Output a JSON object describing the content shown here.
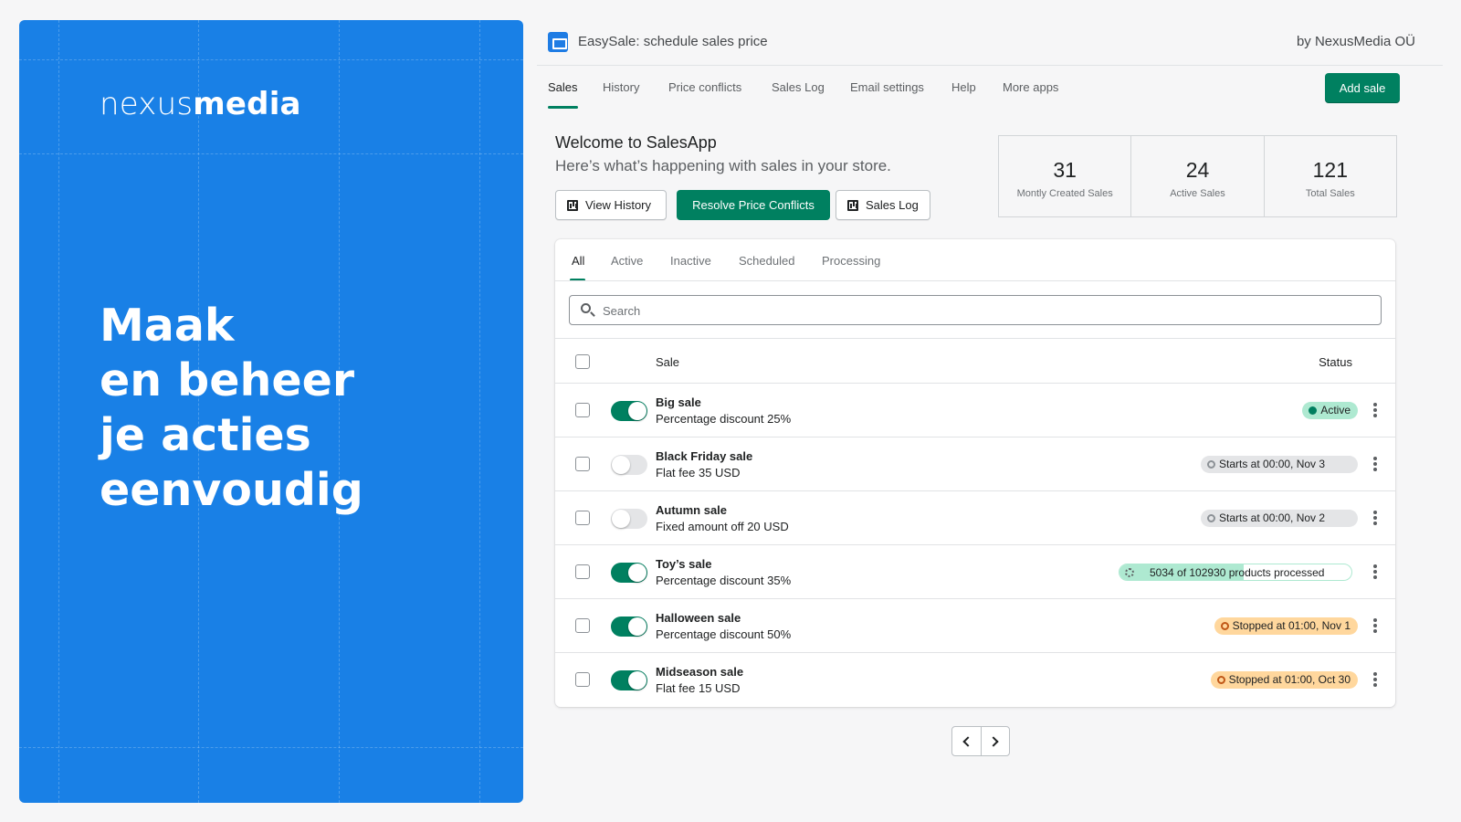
{
  "promo": {
    "logo_light": "nexus",
    "logo_bold": "media",
    "headline": [
      "Maak",
      "en beheer",
      "je acties",
      "eenvoudig"
    ],
    "bg_color": "#1980e6"
  },
  "header": {
    "app_title": "EasySale: schedule sales price",
    "by": "by NexusMedia OÜ"
  },
  "nav": {
    "tabs": [
      "Sales",
      "History",
      "Price conflicts",
      "Sales Log",
      "Email settings",
      "Help",
      "More apps"
    ],
    "active": "Sales",
    "add_button": "Add sale"
  },
  "welcome": {
    "title": "Welcome to SalesApp",
    "subtitle": "Here’s what’s happening with sales in your store.",
    "view_history": "View History",
    "resolve": "Resolve Price Conflicts",
    "sales_log": "Sales Log"
  },
  "stats": [
    {
      "value": "31",
      "label": "Montly Created Sales"
    },
    {
      "value": "24",
      "label": "Active Sales"
    },
    {
      "value": "121",
      "label": "Total Sales"
    }
  ],
  "card": {
    "tabs": [
      "All",
      "Active",
      "Inactive",
      "Scheduled",
      "Processing"
    ],
    "active_tab": "All",
    "search_placeholder": "Search",
    "col_sale": "Sale",
    "col_status": "Status"
  },
  "rows": [
    {
      "title": "Big sale",
      "sub": "Percentage discount 25%",
      "enabled": true,
      "status_type": "active",
      "status": "Active"
    },
    {
      "title": "Black Friday sale",
      "sub": "Flat fee 35 USD",
      "enabled": false,
      "status_type": "scheduled",
      "status": "Starts at 00:00, Nov 3"
    },
    {
      "title": "Autumn sale",
      "sub": "Fixed amount off 20 USD",
      "enabled": false,
      "status_type": "scheduled",
      "status": "Starts at 00:00, Nov 2"
    },
    {
      "title": "Toy’s sale",
      "sub": "Percentage discount 35%",
      "enabled": true,
      "status_type": "progress",
      "status": "5034 of 102930 products processed",
      "progress_fraction": 0.535
    },
    {
      "title": "Halloween sale",
      "sub": "Percentage discount 50%",
      "enabled": true,
      "status_type": "stopped",
      "status": "Stopped at 01:00, Nov 1"
    },
    {
      "title": "Midseason sale",
      "sub": "Flat fee 15 USD",
      "enabled": true,
      "status_type": "stopped",
      "status": "Stopped at 01:00, Oct 30"
    }
  ],
  "colors": {
    "accent_green": "#008060",
    "active_badge": "#aee9d1",
    "stopped_badge": "#ffd79d",
    "scheduled_badge": "#e4e5e7"
  }
}
